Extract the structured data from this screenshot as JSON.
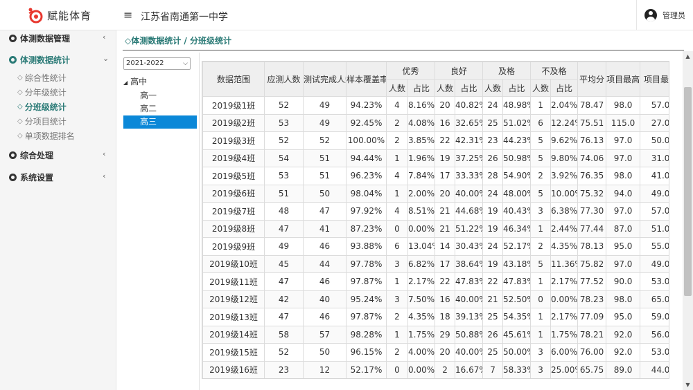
{
  "app": {
    "logo_text": "赋能体育",
    "school_name": "江苏省南通第一中学",
    "user_name": "管理员"
  },
  "colors": {
    "accent": "#2a7a76",
    "selected": "#0b88d8",
    "logo_red": "#e8382f"
  },
  "sidebar": {
    "groups": [
      {
        "label": "体测数据管理",
        "caret": "‹"
      },
      {
        "label": "体测数据统计",
        "caret": "⌄"
      },
      {
        "label": "综合处理",
        "caret": "‹"
      },
      {
        "label": "系统设置",
        "caret": "‹"
      }
    ],
    "sub_icon": "◇",
    "subs": [
      {
        "label": "综合性统计"
      },
      {
        "label": "分年级统计"
      },
      {
        "label": "分班级统计"
      },
      {
        "label": "分项目统计"
      },
      {
        "label": "单项数据排名"
      }
    ]
  },
  "breadcrumb": "◇体测数据统计 / 分班级统计",
  "year_select": {
    "value": "2021-2022"
  },
  "tree": {
    "root": "高中",
    "children": [
      "高一",
      "高二",
      "高三"
    ]
  },
  "table": {
    "h_range": "数据范围",
    "h_expected": "应测人数",
    "h_completed": "测试完成人数",
    "h_coverage": "样本覆盖率",
    "h_excellent": "优秀",
    "h_good": "良好",
    "h_pass": "及格",
    "h_fail": "不及格",
    "h_avg": "平均分",
    "h_max": "项目最高",
    "h_min": "项目最低",
    "sub_count": "人数",
    "sub_ratio": "占比",
    "rows": [
      [
        "2019级1班",
        "52",
        "49",
        "94.23%",
        "4",
        "8.16%",
        "20",
        "40.82%",
        "24",
        "48.98%",
        "1",
        "2.04%",
        "78.47",
        "98.0",
        "57.0"
      ],
      [
        "2019级2班",
        "53",
        "49",
        "92.45%",
        "2",
        "4.08%",
        "16",
        "32.65%",
        "25",
        "51.02%",
        "6",
        "12.24%",
        "75.51",
        "115.0",
        "27.0"
      ],
      [
        "2019级3班",
        "52",
        "52",
        "100.00%",
        "2",
        "3.85%",
        "22",
        "42.31%",
        "23",
        "44.23%",
        "5",
        "9.62%",
        "76.13",
        "97.0",
        "50.0"
      ],
      [
        "2019级4班",
        "54",
        "51",
        "94.44%",
        "1",
        "1.96%",
        "19",
        "37.25%",
        "26",
        "50.98%",
        "5",
        "9.80%",
        "74.06",
        "97.0",
        "31.0"
      ],
      [
        "2019级5班",
        "53",
        "51",
        "96.23%",
        "4",
        "7.84%",
        "17",
        "33.33%",
        "28",
        "54.90%",
        "2",
        "3.92%",
        "76.35",
        "98.0",
        "41.0"
      ],
      [
        "2019级6班",
        "51",
        "50",
        "98.04%",
        "1",
        "2.00%",
        "20",
        "40.00%",
        "24",
        "48.00%",
        "5",
        "10.00%",
        "75.32",
        "94.0",
        "49.0"
      ],
      [
        "2019级7班",
        "48",
        "47",
        "97.92%",
        "4",
        "8.51%",
        "21",
        "44.68%",
        "19",
        "40.43%",
        "3",
        "6.38%",
        "77.30",
        "97.0",
        "57.0"
      ],
      [
        "2019级8班",
        "47",
        "41",
        "87.23%",
        "0",
        "0.00%",
        "21",
        "51.22%",
        "19",
        "46.34%",
        "1",
        "2.44%",
        "77.44",
        "87.0",
        "51.0"
      ],
      [
        "2019级9班",
        "49",
        "46",
        "93.88%",
        "6",
        "13.04%",
        "14",
        "30.43%",
        "24",
        "52.17%",
        "2",
        "4.35%",
        "78.13",
        "95.0",
        "55.0"
      ],
      [
        "2019级10班",
        "45",
        "44",
        "97.78%",
        "3",
        "6.82%",
        "17",
        "38.64%",
        "19",
        "43.18%",
        "5",
        "11.36%",
        "75.82",
        "97.0",
        "49.0"
      ],
      [
        "2019级11班",
        "47",
        "46",
        "97.87%",
        "1",
        "2.17%",
        "22",
        "47.83%",
        "22",
        "47.83%",
        "1",
        "2.17%",
        "77.52",
        "90.0",
        "53.0"
      ],
      [
        "2019级12班",
        "42",
        "40",
        "95.24%",
        "3",
        "7.50%",
        "16",
        "40.00%",
        "21",
        "52.50%",
        "0",
        "0.00%",
        "78.23",
        "98.0",
        "65.0"
      ],
      [
        "2019级13班",
        "47",
        "46",
        "97.87%",
        "2",
        "4.35%",
        "18",
        "39.13%",
        "25",
        "54.35%",
        "1",
        "2.17%",
        "77.09",
        "95.0",
        "59.0"
      ],
      [
        "2019级14班",
        "58",
        "57",
        "98.28%",
        "1",
        "1.75%",
        "29",
        "50.88%",
        "26",
        "45.61%",
        "1",
        "1.75%",
        "78.21",
        "92.0",
        "56.0"
      ],
      [
        "2019级15班",
        "52",
        "50",
        "96.15%",
        "2",
        "4.00%",
        "20",
        "40.00%",
        "25",
        "50.00%",
        "3",
        "6.00%",
        "76.00",
        "92.0",
        "53.0"
      ],
      [
        "2019级16班",
        "23",
        "12",
        "52.17%",
        "0",
        "0.00%",
        "2",
        "16.67%",
        "7",
        "58.33%",
        "3",
        "25.00%",
        "65.75",
        "89.0",
        "44.0"
      ]
    ]
  },
  "scrollbar": {
    "up": "▲",
    "down": "▼"
  }
}
